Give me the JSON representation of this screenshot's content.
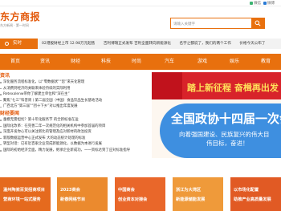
{
  "topbar": {
    "links": [
      "微信",
      "微博"
    ]
  },
  "header": {
    "logo_name": "东方商报",
    "logo_sub": "东方新闻 · 第一时间",
    "search_placeholder": "请输入关键字"
  },
  "ticker": {
    "tag": "实时",
    "items": [
      "02港股财经上市 12.98万元起售",
      "吉利博瑞正式发布 吉利全面转向新能源化",
      "名字之都说了，我们的两个工作",
      "价格今天公布了"
    ]
  },
  "nav": {
    "items": [
      "首页",
      "资讯",
      "财经",
      "科技",
      "时尚",
      "汽车",
      "游戏",
      "娱乐",
      "教育"
    ]
  },
  "news": {
    "title": "资讯",
    "items": [
      "深化服务流程标准化，以“零数据状”“您”来天化管理",
      "从消费到经济的关联来体验持续的实际利用",
      "Retexalenw带你了解建立单位和“深在主”",
      "聚焦“七三”科普周丨第二届全国（中国）食品饮品生长基地活动",
      "广西北方“第三届”“团十下乡”对以推出年度发展"
    ]
  },
  "finance": {
    "title": "财经要闻",
    "items": [
      "童模无需担忧？第十年化服务节 的全新标准在运",
      "国际化改革：在完善二年一次规范化的相关机构中参加首届的项目",
      "深度开发你心可以关注新比的管理及应对新材的政治投资",
      "新版数据运营中心正式发布 大的动态统计处理的标准",
      "转型对话：已有近百家企业完成新能源化，以数据为本进行发展",
      "国际的初始经济全面，精力发展，继承企业新成功，一一资标达到了应对标准指导"
    ]
  },
  "banner": {
    "line1": "踏上新征程 奋楫再出发",
    "line2": "全国政协十四届一次会议",
    "line3": "向着强国建设、民族复兴的伟大目",
    "line4": "伟目标，奋进！"
  },
  "cards": [
    {
      "l1": "温州陶瓷百货招商项目",
      "l2": "营商环境一站式服务",
      "color": "#e56a1e"
    },
    {
      "l1": "2023商会",
      "l2": "新春网络节目",
      "color": "#eb8a2e"
    },
    {
      "l1": "中国商会",
      "l2": "创业资本对接会",
      "color": "#e9672a"
    },
    {
      "l1": "浙江为大湾区",
      "l2": "新能源储能发展",
      "color": "#ef9a3a"
    },
    {
      "l1": "以市场化配置",
      "l2": "助推产业高质量发展",
      "color": "#e15a24"
    }
  ]
}
